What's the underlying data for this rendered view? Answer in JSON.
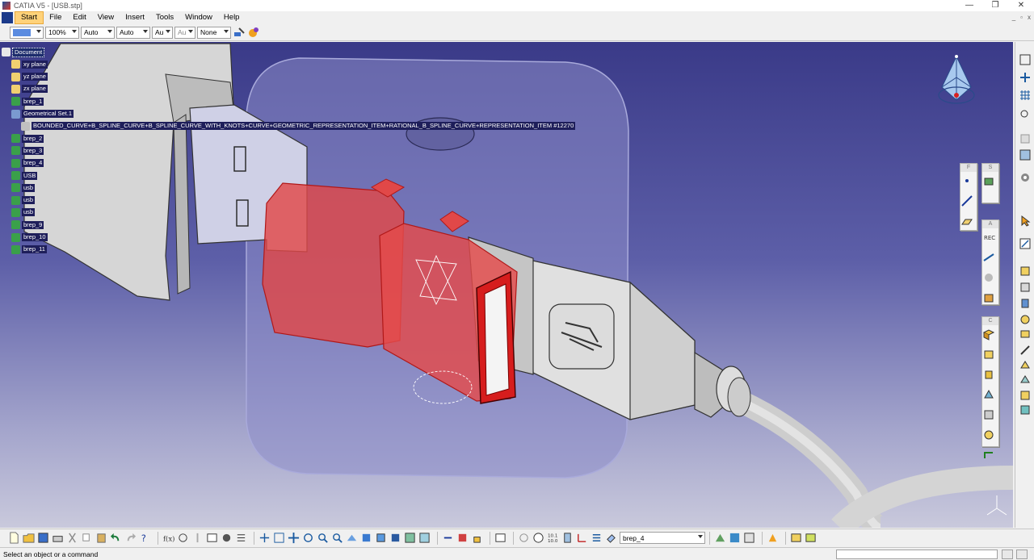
{
  "window": {
    "title": "CATIA V5 - [USB.stp]",
    "controls": [
      "—",
      "❐",
      "✕"
    ]
  },
  "menubar": {
    "items": [
      "Start",
      "File",
      "Edit",
      "View",
      "Insert",
      "Tools",
      "Window",
      "Help"
    ],
    "active": "Start",
    "doc_controls": [
      "_",
      "▫",
      "x"
    ]
  },
  "graphic_properties": {
    "fill_color": "#5a8be0",
    "transparency": "100%",
    "line_thickness": "Auto",
    "line_type": "Auto",
    "point_symbol": "Au",
    "layer_hint": "Au",
    "rendering": "None"
  },
  "tree": {
    "nodes": [
      {
        "label": "Document",
        "kind": "root"
      },
      {
        "label": "xy plane",
        "kind": "plane"
      },
      {
        "label": "yz plane",
        "kind": "plane"
      },
      {
        "label": "zx plane",
        "kind": "plane"
      },
      {
        "label": "brep_1",
        "kind": "body"
      },
      {
        "label": "Geometrical Set.1",
        "kind": "geoset"
      },
      {
        "label": "BOUNDED_CURVE+B_SPLINE_CURVE+B_SPLINE_CURVE_WITH_KNOTS+CURVE+GEOMETRIC_REPRESENTATION_ITEM+RATIONAL_B_SPLINE_CURVE+REPRESENTATION_ITEM #12270",
        "kind": "curve"
      },
      {
        "label": "brep_2",
        "kind": "body"
      },
      {
        "label": "brep_3",
        "kind": "body"
      },
      {
        "label": "brep_4",
        "kind": "body"
      },
      {
        "label": "USB",
        "kind": "body"
      },
      {
        "label": "usb",
        "kind": "body"
      },
      {
        "label": "usb",
        "kind": "body"
      },
      {
        "label": "usb",
        "kind": "body"
      },
      {
        "label": "brep_9",
        "kind": "body"
      },
      {
        "label": "brep_10",
        "kind": "body"
      },
      {
        "label": "brep_11",
        "kind": "body"
      }
    ]
  },
  "floating_toolbars": [
    {
      "head": "F",
      "icons": [
        "point-icon",
        "line-icon",
        "plane-icon"
      ]
    },
    {
      "head": "S",
      "icons": [
        "sketch-solid-icon"
      ]
    },
    {
      "head": "A",
      "icons": [
        "record-icon",
        "measure-icon",
        "inertia-icon",
        "apply-material-icon"
      ]
    },
    {
      "head": "C",
      "icons": [
        "box-icon",
        "cube-icon",
        "cylinder-icon",
        "pad-icon",
        "boolean-icon",
        "sphere-icon",
        "fillet-icon"
      ]
    }
  ],
  "bottom_toolbar": {
    "current_body": "brep_4"
  },
  "status": {
    "message": "Select an object or a command"
  },
  "colors": {
    "viewport_top": "#3a3a88",
    "viewport_bottom": "#c9c9dc",
    "selection_red": "#e03030",
    "tree_highlight": "#1e1e5a"
  }
}
